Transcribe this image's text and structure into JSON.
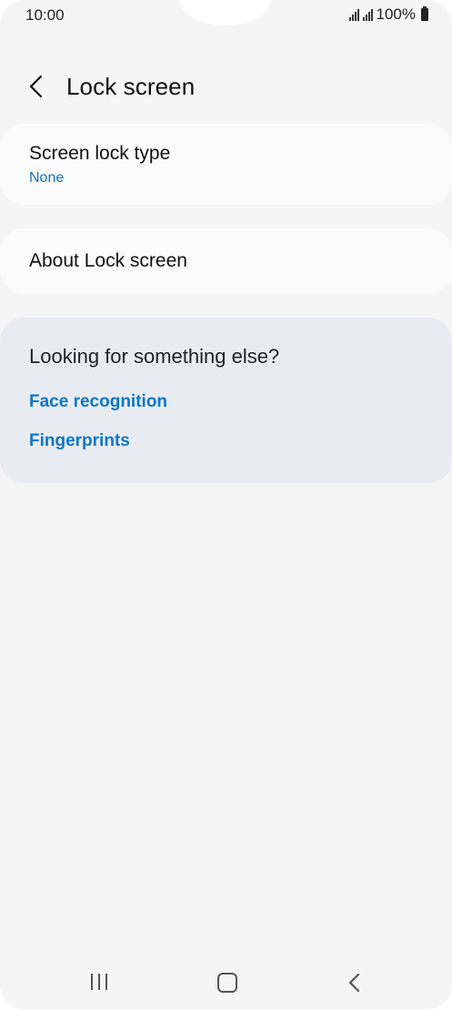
{
  "status_bar": {
    "time": "10:00",
    "battery": "100%",
    "icons": [
      "signal-icon",
      "signal-icon",
      "battery-icon"
    ]
  },
  "header": {
    "title": "Lock screen",
    "back_icon": "chevron-left-icon"
  },
  "settings": {
    "screen_lock_type": {
      "title": "Screen lock type",
      "value": "None"
    },
    "about": {
      "title": "About Lock screen"
    }
  },
  "suggestions": {
    "title": "Looking for something else?",
    "links": [
      "Face recognition",
      "Fingerprints"
    ]
  },
  "nav_bar": {
    "icons": [
      "recents-icon",
      "home-icon",
      "back-icon"
    ]
  },
  "colors": {
    "accent": "#0d75c8",
    "background": "#f5f5f5",
    "card": "#fbfbfb",
    "suggestion_card": "#e8ecf2"
  }
}
